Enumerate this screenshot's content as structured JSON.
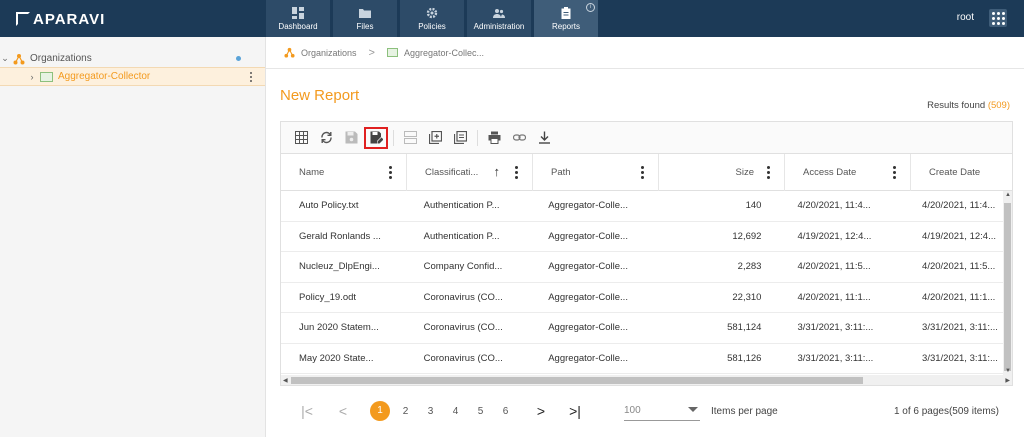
{
  "app": {
    "logo_text": "APARAVI",
    "user": "root"
  },
  "nav": [
    {
      "label": "Dashboard",
      "icon": "dashboard-icon"
    },
    {
      "label": "Files",
      "icon": "folder-icon"
    },
    {
      "label": "Policies",
      "icon": "gear-icon"
    },
    {
      "label": "Administration",
      "icon": "users-icon"
    },
    {
      "label": "Reports",
      "icon": "clipboard-icon",
      "active": true
    }
  ],
  "sidebar": {
    "org_label": "Organizations",
    "collector_label": "Aggregator-Collector"
  },
  "breadcrumb": {
    "org": "Organizations",
    "sep": ">",
    "collector": "Aggregator-Collec..."
  },
  "report": {
    "title": "New Report",
    "results_label": "Results found",
    "results_count": "(509)"
  },
  "toolbar": {
    "icons": [
      "grid-icon",
      "refresh-icon",
      "save-icon",
      "save-as-icon",
      "split-icon",
      "add-copy-icon",
      "copy-icon",
      "print-icon",
      "link-icon",
      "download-icon"
    ],
    "highlighted": "save-as-icon"
  },
  "table": {
    "columns": [
      {
        "label": "Name"
      },
      {
        "label": "Classificati..."
      },
      {
        "label": "Path"
      },
      {
        "label": "Size"
      },
      {
        "label": "Access Date"
      },
      {
        "label": "Create Date"
      }
    ],
    "rows": [
      [
        "Auto Policy.txt",
        "Authentication P...",
        "Aggregator-Colle...",
        "140",
        "4/20/2021, 11:4...",
        "4/20/2021, 11:4..."
      ],
      [
        "Gerald Ronlands ...",
        "Authentication P...",
        "Aggregator-Colle...",
        "12,692",
        "4/19/2021, 12:4...",
        "4/19/2021, 12:4..."
      ],
      [
        "Nucleuz_DlpEngi...",
        "Company Confid...",
        "Aggregator-Colle...",
        "2,283",
        "4/20/2021, 11:5...",
        "4/20/2021, 11:5..."
      ],
      [
        "Policy_19.odt",
        "Coronavirus (CO...",
        "Aggregator-Colle...",
        "22,310",
        "4/20/2021, 11:1...",
        "4/20/2021, 11:1..."
      ],
      [
        "Jun 2020 Statem...",
        "Coronavirus (CO...",
        "Aggregator-Colle...",
        "581,124",
        "3/31/2021, 3:11:...",
        "3/31/2021, 3:11:..."
      ],
      [
        "May 2020 State...",
        "Coronavirus (CO...",
        "Aggregator-Colle...",
        "581,126",
        "3/31/2021, 3:11:...",
        "3/31/2021, 3:11:..."
      ]
    ]
  },
  "pager": {
    "first": "|<",
    "prev": "<",
    "pages": [
      "1",
      "2",
      "3",
      "4",
      "5",
      "6"
    ],
    "current": "1",
    "next": ">",
    "last": ">|",
    "per_page": "100",
    "per_page_label": "Items per page",
    "summary": "1 of 6 pages(509 items)"
  },
  "colors": {
    "topbar": "#1c3a57",
    "accent": "#f39a1e",
    "highlight_border": "#e02020"
  }
}
